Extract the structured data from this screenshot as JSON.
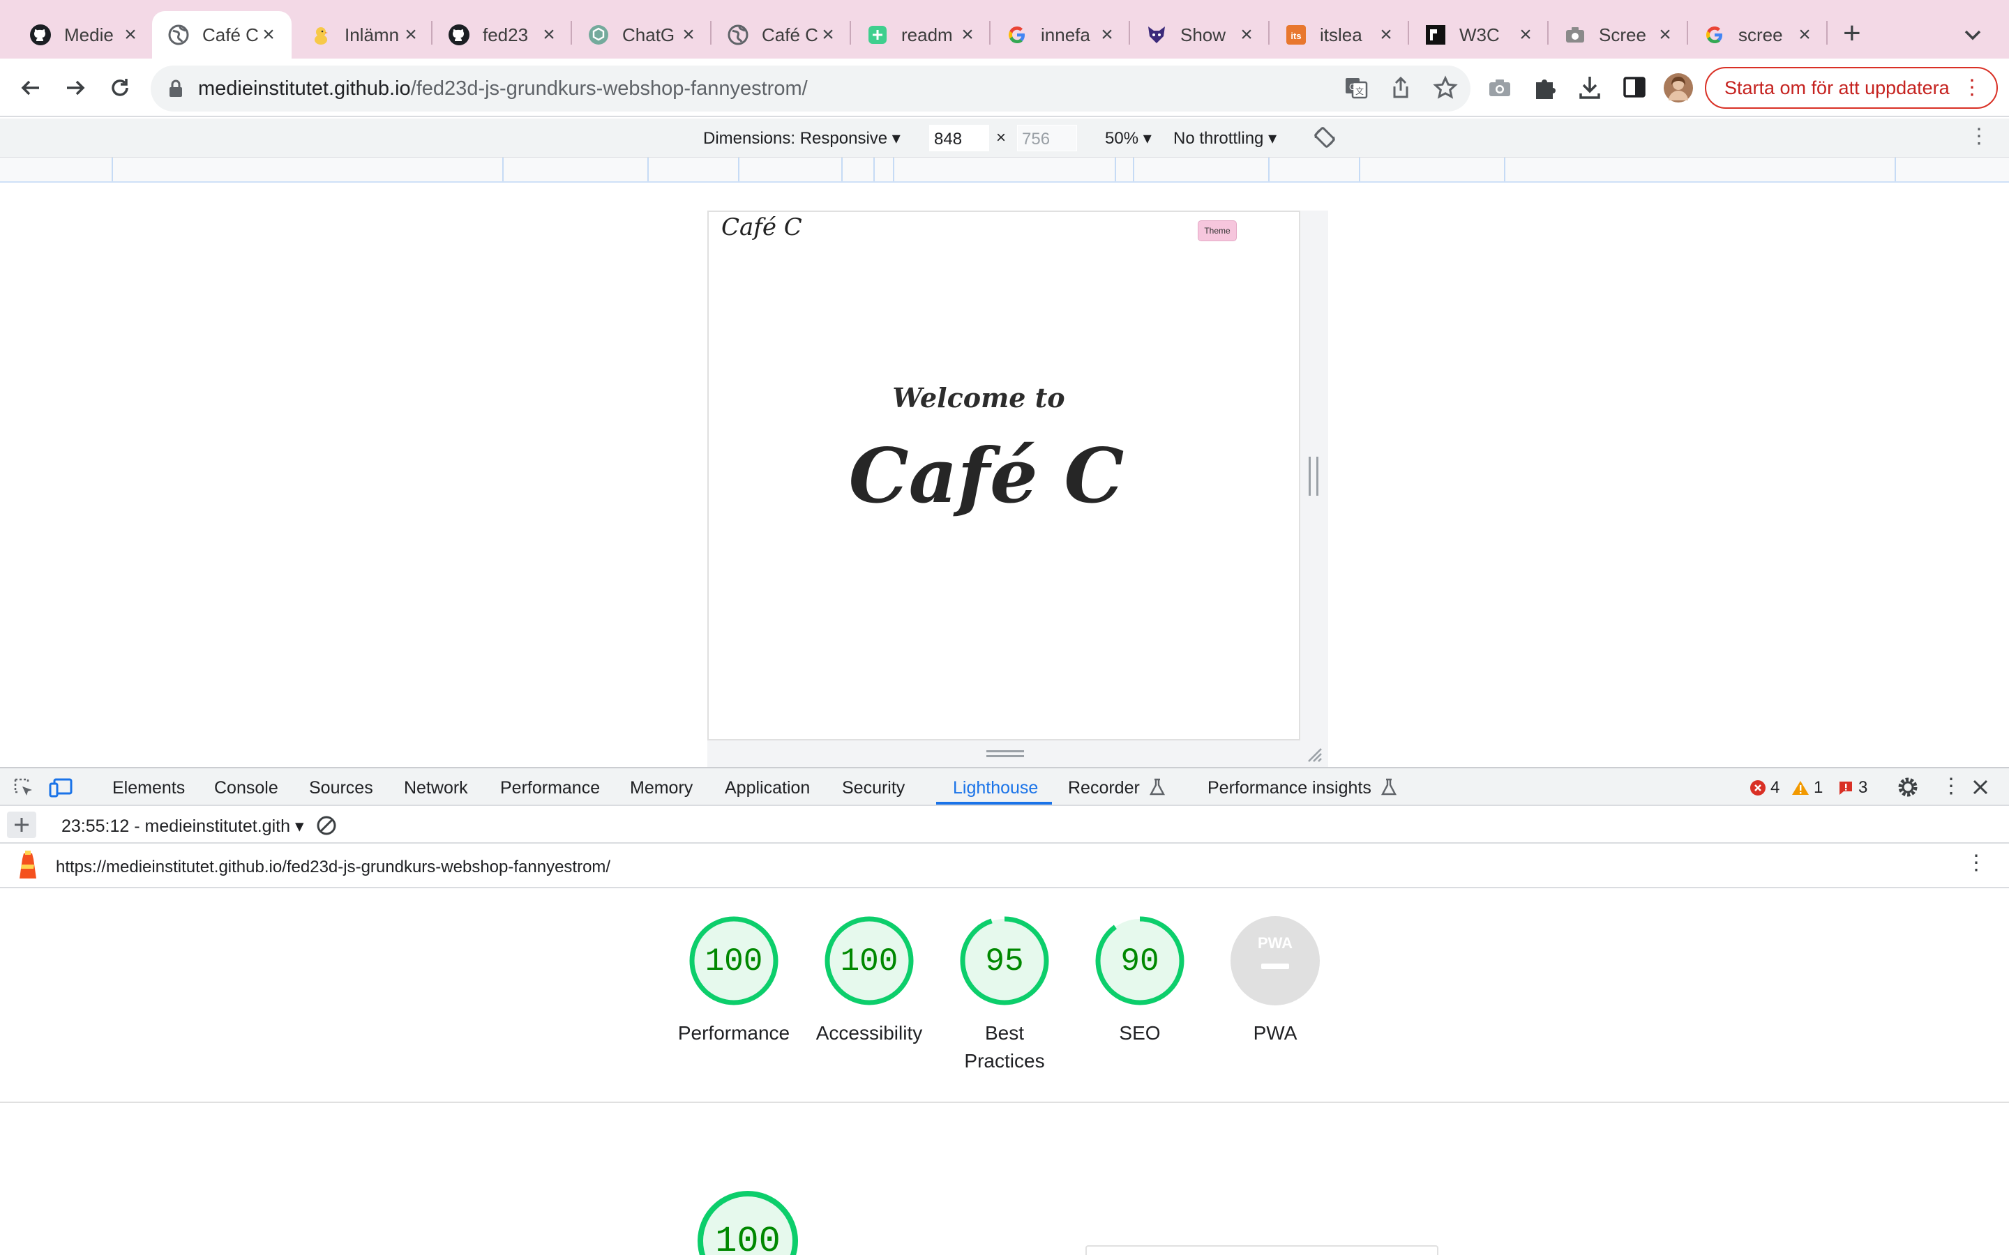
{
  "browser": {
    "tabs": [
      {
        "title": "Medie",
        "icon": "github-icon",
        "active": false
      },
      {
        "title": "Café C",
        "icon": "globe-icon",
        "active": true
      },
      {
        "title": "Inlämn",
        "icon": "chick-icon",
        "active": false
      },
      {
        "title": "fed23",
        "icon": "github-icon",
        "active": false
      },
      {
        "title": "ChatG",
        "icon": "chatgpt-icon",
        "active": false
      },
      {
        "title": "Café C",
        "icon": "globe-icon",
        "active": false
      },
      {
        "title": "readm",
        "icon": "readme-icon",
        "active": false
      },
      {
        "title": "innefa",
        "icon": "google-icon",
        "active": false
      },
      {
        "title": "Show",
        "icon": "fox-icon",
        "active": false
      },
      {
        "title": "itslea",
        "icon": "itslearning-icon",
        "active": false
      },
      {
        "title": "W3C",
        "icon": "w3c-icon",
        "active": false
      },
      {
        "title": "Scree",
        "icon": "camera-icon",
        "active": false
      },
      {
        "title": "scree",
        "icon": "google-icon",
        "active": false
      }
    ],
    "close_glyph": "×",
    "new_tab_glyph": "+",
    "address": {
      "host": "medieinstitutet.github.io",
      "path": "/fed23d-js-grundkurs-webshop-fannyestrom/"
    },
    "update_button": "Starta om för att uppdatera",
    "menu_glyph": "⋮"
  },
  "device_toolbar": {
    "dimensions_label": "Dimensions: Responsive",
    "width": "848",
    "times": "×",
    "height_placeholder": "756",
    "zoom": "50%",
    "throttling": "No throttling",
    "caret": "▾"
  },
  "page": {
    "brand": "Café C",
    "theme_button": "Theme",
    "welcome": "Welcome to",
    "hero_title": "Café C"
  },
  "devtools": {
    "tabs": [
      "Elements",
      "Console",
      "Sources",
      "Network",
      "Performance",
      "Memory",
      "Application",
      "Security",
      "Lighthouse",
      "Recorder",
      "Performance insights"
    ],
    "active_tab": "Lighthouse",
    "counts": {
      "errors": "4",
      "warnings": "1",
      "issues": "3"
    },
    "report_selector": "23:55:12 - medieinstitutet.gith",
    "report_url": "https://medieinstitutet.github.io/fed23d-js-grundkurs-webshop-fannyestrom/"
  },
  "lighthouse": {
    "scores": [
      {
        "label": "Performance",
        "value": "100",
        "score": 100
      },
      {
        "label": "Accessibility",
        "value": "100",
        "score": 100
      },
      {
        "label": "Best Practices",
        "value": "95",
        "score": 95
      },
      {
        "label": "SEO",
        "value": "90",
        "score": 90
      },
      {
        "label": "PWA",
        "value": "PWA",
        "score": null
      }
    ],
    "section_score": "100",
    "colors": {
      "pass": "#0cce6b",
      "pass_text": "#008800",
      "pass_bg": "#e6f9ed",
      "na": "#e0e0e0"
    }
  }
}
